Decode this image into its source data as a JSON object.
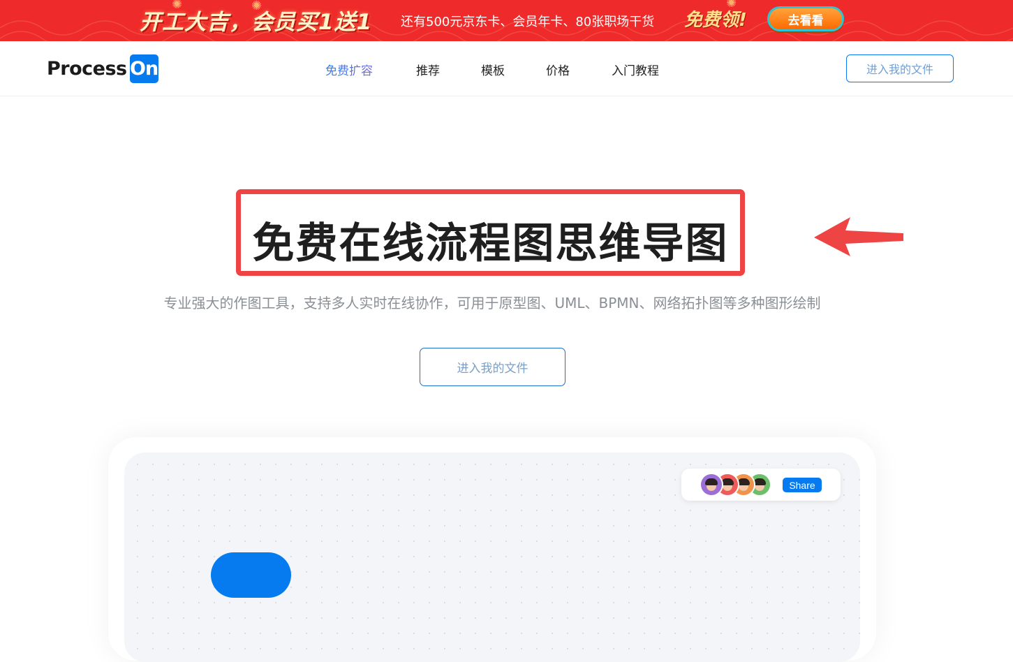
{
  "promo": {
    "slogan": "开工大吉，会员买1送1",
    "description": "还有500元京东卡、会员年卡、80张职场干货",
    "highlight": "免费领!",
    "button_label": "去看看",
    "background_color": "#ee2a2a"
  },
  "header": {
    "logo_text": "Process",
    "logo_badge": "On",
    "nav": [
      {
        "label": "免费扩容",
        "active": true
      },
      {
        "label": "推荐"
      },
      {
        "label": "模板"
      },
      {
        "label": "价格"
      },
      {
        "label": "入门教程"
      }
    ],
    "cta_label": "进入我的文件",
    "brand_color": "#067bef"
  },
  "hero": {
    "title": "免费在线流程图思维导图",
    "subtitle": "专业强大的作图工具，支持多人实时在线协作，可用于原型图、UML、BPMN、网络拓扑图等多种图形绘制",
    "cta_label": "进入我的文件",
    "annotation_color": "#ee4444"
  },
  "preview": {
    "share_label": "Share",
    "avatars": [
      "#9b6fd6",
      "#ef5a5a",
      "#f0934c",
      "#6bbf6a"
    ]
  }
}
